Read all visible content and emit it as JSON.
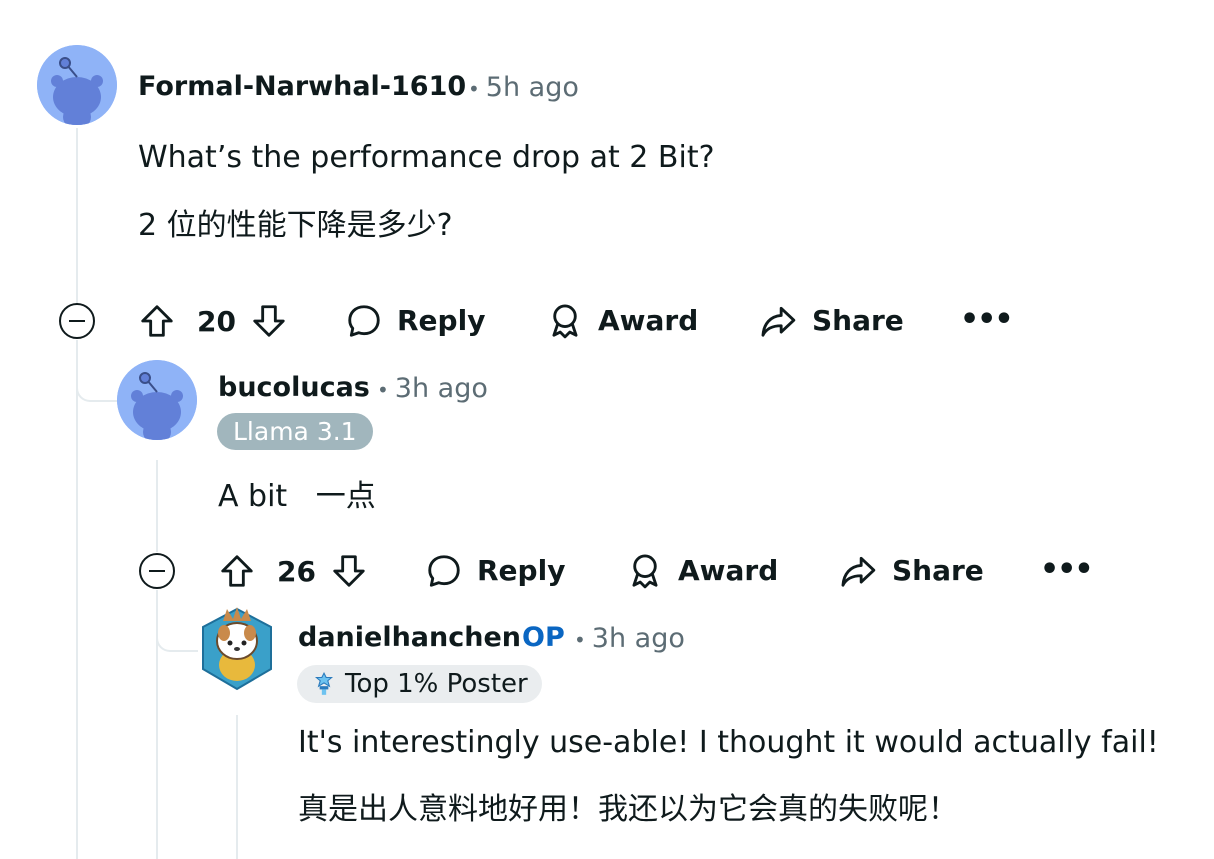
{
  "comments": [
    {
      "username": "Formal-Narwhal-1610",
      "time": "5h ago",
      "body": [
        "What’s the performance drop at 2 Bit?",
        "2 位的性能下降是多少?"
      ],
      "votes": "20",
      "actions": {
        "reply": "Reply",
        "award": "Award",
        "share": "Share",
        "more": "•••"
      }
    },
    {
      "username": "bucolucas",
      "time": "3h ago",
      "flair": "Llama 3.1",
      "body": [
        "A bit   一点"
      ],
      "votes": "26",
      "actions": {
        "reply": "Reply",
        "award": "Award",
        "share": "Share",
        "more": "•••"
      }
    },
    {
      "username": "danielhanchen",
      "op_label": "OP",
      "time": "3h ago",
      "flair": "Top 1% Poster",
      "body": [
        "It's interestingly use-able! I thought it would actually fail!",
        "真是出人意料地好用！我还以为它会真的失败呢！"
      ]
    }
  ],
  "colors": {
    "op": "#0a66c2",
    "flair_grey": "#a1b6bd",
    "avatar_blue": "#8fb3f7"
  }
}
